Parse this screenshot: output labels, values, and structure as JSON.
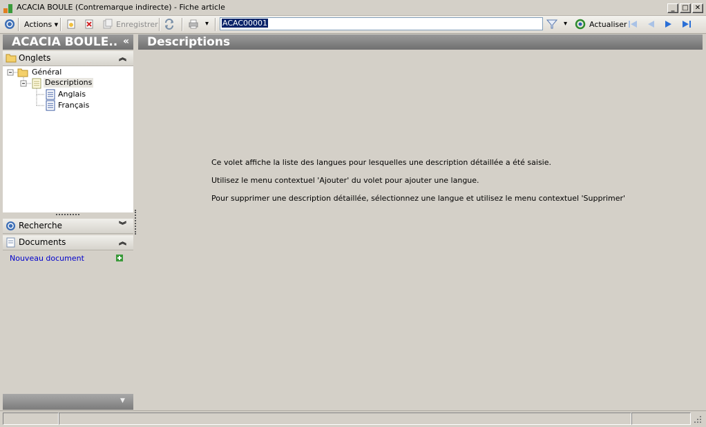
{
  "window": {
    "title": "ACACIA BOULE (Contremarque indirecte) - Fiche article",
    "controls": {
      "minimize": "_",
      "maximize": "□",
      "close": "✕"
    }
  },
  "toolbar": {
    "actions_label": "Actions",
    "save_label": "Enregistrer",
    "record_code": "ACAC00001",
    "refresh_label": "Actualiser"
  },
  "left_panel": {
    "title": "ACACIA BOULE..",
    "collapse_glyph": "«",
    "sections": {
      "tabs_label": "Onglets",
      "search_label": "Recherche",
      "documents_label": "Documents",
      "new_document_label": "Nouveau document"
    },
    "tree": {
      "root": "Général",
      "child": "Descriptions",
      "leaves": [
        "Anglais",
        "Français"
      ]
    }
  },
  "main": {
    "title": "Descriptions",
    "messages": [
      "Ce volet affiche la liste des langues pour lesquelles une description détaillée a été saisie.",
      "Utilisez le menu contextuel 'Ajouter' du volet pour ajouter une langue.",
      "Pour supprimer une description détaillée, sélectionnez une langue et utilisez le menu contextuel 'Supprimer'"
    ]
  },
  "colors": {
    "panel_bg": "#d4d0c8",
    "header_gray": "#808080",
    "link_blue": "#0000cc",
    "nav_blue": "#2a6fd6",
    "selection": "#0a246a"
  },
  "icons": [
    "app-icon",
    "circle-menu-icon",
    "new-record-icon",
    "delete-icon",
    "save-icon",
    "sync-icon",
    "print-icon",
    "filter-icon",
    "refresh-icon",
    "first-icon",
    "previous-icon",
    "next-icon",
    "last-icon",
    "folder-icon",
    "document-icon",
    "search-circle-icon",
    "add-icon"
  ]
}
